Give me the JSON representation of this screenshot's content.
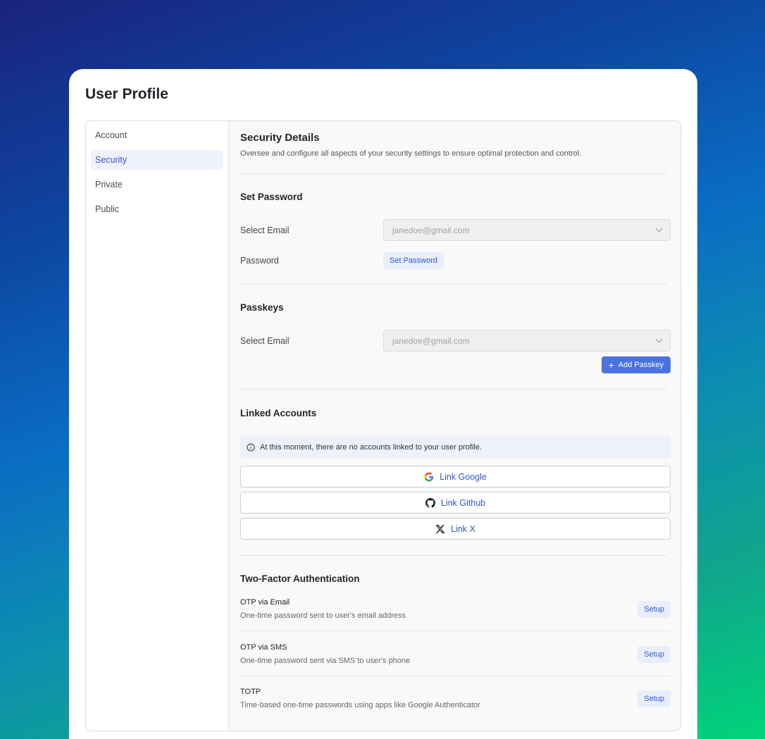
{
  "page": {
    "title": "User Profile"
  },
  "sidebar": {
    "items": [
      {
        "label": "Account"
      },
      {
        "label": "Security"
      },
      {
        "label": "Private"
      },
      {
        "label": "Public"
      }
    ],
    "active": "Security"
  },
  "header": {
    "title": "Security Details",
    "description": "Oversee and configure all aspects of your security settings to ensure optimal protection and control."
  },
  "set_password": {
    "title": "Set Password",
    "email_label": "Select Email",
    "email_value": "janedoe@gmail.com",
    "password_label": "Password",
    "button": "Set Password"
  },
  "passkeys": {
    "title": "Passkeys",
    "email_label": "Select Email",
    "email_value": "janedoe@gmail.com",
    "add_button": "Add Passkey"
  },
  "linked_accounts": {
    "title": "Linked Accounts",
    "info": "At this moment, there are no accounts linked to your user profile.",
    "google": "Link Google",
    "github": "Link Github",
    "x": "Link X"
  },
  "two_factor": {
    "title": "Two-Factor Authentication",
    "items": [
      {
        "name": "OTP via Email",
        "desc": "One-time password sent to user's email address",
        "button": "Setup"
      },
      {
        "name": "OTP via SMS",
        "desc": "One-time password sent via SMS to user's phone",
        "button": "Setup"
      },
      {
        "name": "TOTP",
        "desc": "Time-based one-time passwords using apps like Google Authenticator",
        "button": "Setup"
      }
    ]
  },
  "colors": {
    "accent": "#2f55d4",
    "primary_button": "#4a72e0",
    "active_nav_bg": "#eef2fd"
  }
}
